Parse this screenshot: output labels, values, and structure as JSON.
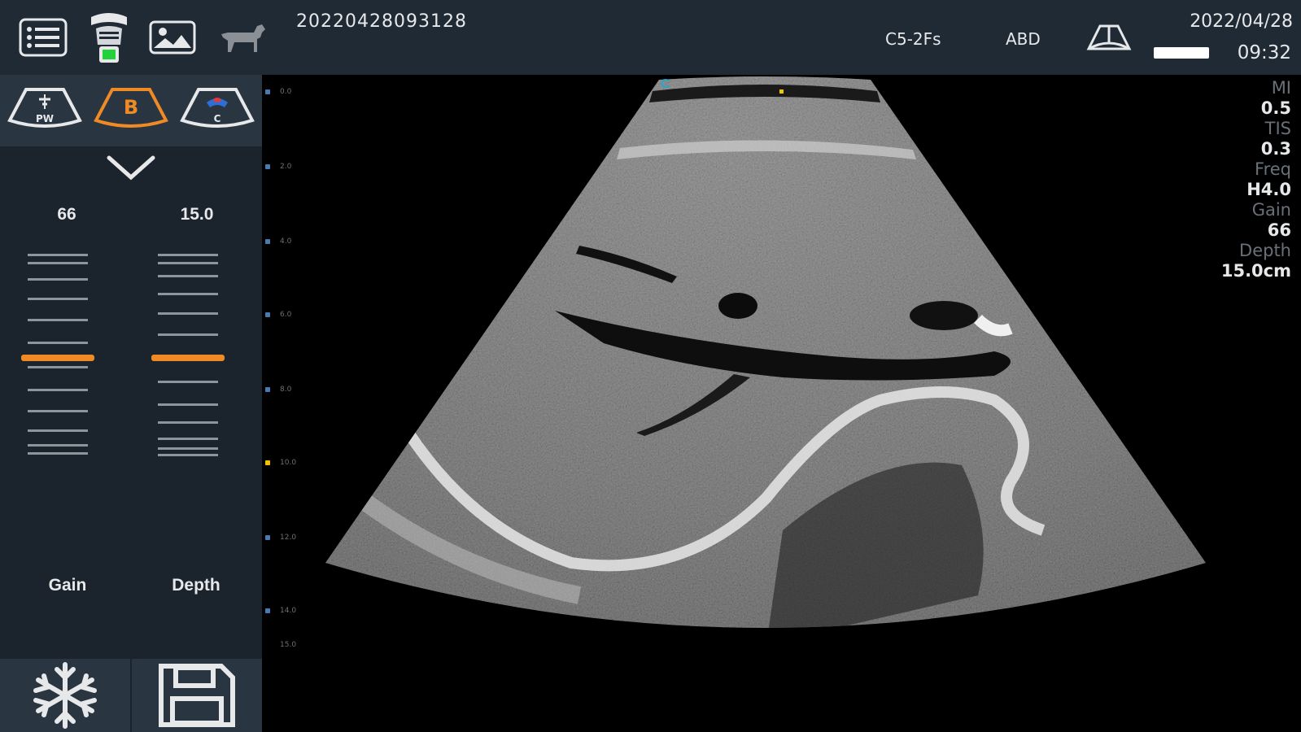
{
  "topbar": {
    "patient_id": "20220428093128",
    "probe": "C5-2Fs",
    "preset": "ABD",
    "date": "2022/04/28",
    "time": "09:32",
    "icons": [
      "list-icon",
      "probe-icon",
      "image-gallery-icon",
      "dog-icon",
      "sector-icon"
    ]
  },
  "modes": [
    {
      "name": "PW",
      "label": "PW"
    },
    {
      "name": "B",
      "label": "B"
    },
    {
      "name": "C",
      "label": "C"
    }
  ],
  "controls": {
    "gain": {
      "label": "Gain",
      "value": "66"
    },
    "depth": {
      "label": "Depth",
      "value": "15.0"
    }
  },
  "params": {
    "mi_label": "MI",
    "mi_value": "0.5",
    "tis_label": "TIS",
    "tis_value": "0.3",
    "freq_label": "Freq",
    "freq_value": "H4.0",
    "gain_label": "Gain",
    "gain_value": "66",
    "depth_label": "Depth",
    "depth_value": "15.0cm"
  },
  "scale_labels": [
    "0.0",
    "2.0",
    "4.0",
    "6.0",
    "8.0",
    "10.0",
    "12.0",
    "14.0",
    "15.0"
  ],
  "orientation_marker": "C",
  "colors": {
    "accent": "#f08a24",
    "topbar": "#1f2a35",
    "panel": "#1b232c",
    "probe_indicator": "#22d23a"
  }
}
